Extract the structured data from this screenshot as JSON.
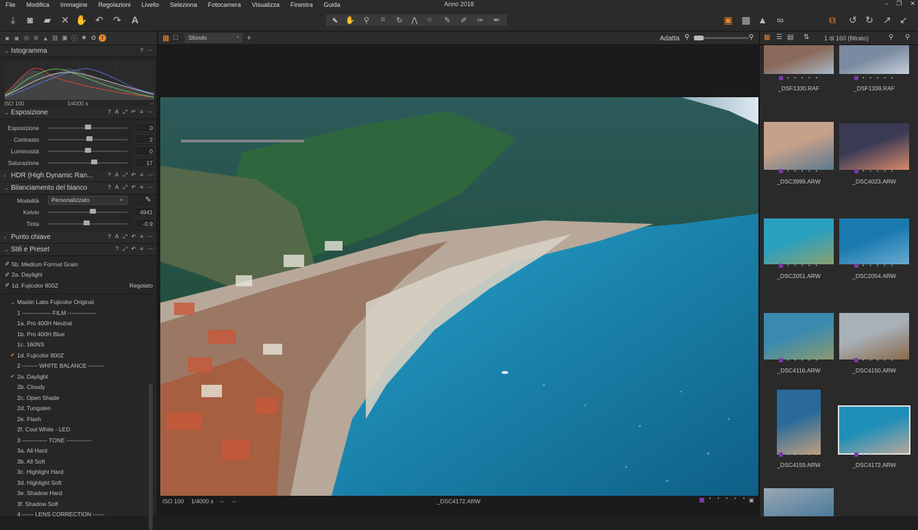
{
  "menu": {
    "items": [
      "File",
      "Modifica",
      "Immagine",
      "Regolazioni",
      "Livello",
      "Seleziona",
      "Fotocamera",
      "Visualizza",
      "Finestra",
      "Guida"
    ],
    "title": "Anno 2018"
  },
  "left": {
    "histogram": {
      "title": "Istogramma",
      "iso": "ISO 100",
      "shutter": "1/4000 s",
      "dash": "--"
    },
    "exposure": {
      "title": "Esposizione",
      "sliders": [
        {
          "label": "Esposizione",
          "value": "0",
          "pos": 0.5
        },
        {
          "label": "Contrasto",
          "value": "2",
          "pos": 0.52
        },
        {
          "label": "Luminosità",
          "value": "0",
          "pos": 0.5
        },
        {
          "label": "Saturazione",
          "value": "17",
          "pos": 0.58
        }
      ]
    },
    "hdr": {
      "title": "HDR (High Dynamic Ran..."
    },
    "wb": {
      "title": "Bilanciamento del bianco",
      "mode_label": "Modalità",
      "mode_value": "Personalizzato",
      "sliders": [
        {
          "label": "Kelvin",
          "value": "4941",
          "pos": 0.56
        },
        {
          "label": "Tinta",
          "value": "-0.9",
          "pos": 0.48
        }
      ]
    },
    "keypoint": {
      "title": "Punto chiave"
    },
    "styles": {
      "title": "Stili e Preset",
      "applied": [
        "5b. Medium Format Grain",
        "2a. Daylight",
        "1d. Fujicolor 800Z"
      ],
      "adjusted": "Regolato",
      "group": "Mastin Labs Fujicolor Original",
      "presets": [
        {
          "name": "1 --------------- FILM ---------------",
          "checked": false
        },
        {
          "name": "1a. Pro 400H Neutral",
          "checked": false
        },
        {
          "name": "1b. Pro 400H Blue",
          "checked": false
        },
        {
          "name": "1c. 160NS",
          "checked": false
        },
        {
          "name": "1d. Fujicolor 800Z",
          "checked": true
        },
        {
          "name": "2 -------- WHITE BALANCE --------",
          "checked": false
        },
        {
          "name": "2a. Daylight",
          "checked": true
        },
        {
          "name": "2b. Cloudy",
          "checked": false
        },
        {
          "name": "2c. Open Shade",
          "checked": false
        },
        {
          "name": "2d. Tungsten",
          "checked": false
        },
        {
          "name": "2e. Flash",
          "checked": false
        },
        {
          "name": "2f. Cool White - LED",
          "checked": false
        },
        {
          "name": "3 ------------- TONE -------------",
          "checked": false
        },
        {
          "name": "3a. All Hard",
          "checked": false
        },
        {
          "name": "3b. All Soft",
          "checked": false
        },
        {
          "name": "3c. Highlight Hard",
          "checked": false
        },
        {
          "name": "3d. Highlight Soft",
          "checked": false
        },
        {
          "name": "3e. Shadow Hard",
          "checked": false
        },
        {
          "name": "3f. Shadow Soft",
          "checked": false
        },
        {
          "name": "4 ------ LENS CORRECTION ------",
          "checked": false
        }
      ]
    }
  },
  "viewer": {
    "background_select": "Sfondo",
    "fit_label": "Adatta",
    "iso": "ISO 100",
    "shutter": "1/4000 s",
    "dashes": "--",
    "filename": "_DSC4172.ARW"
  },
  "browser": {
    "count": "1 di 160 (filtrato)",
    "thumbs": [
      {
        "name": "_DSF1330.RAF"
      },
      {
        "name": "_DSF1339.RAF"
      },
      {
        "name": "_DSC3999.ARW"
      },
      {
        "name": "_DSC4023.ARW"
      },
      {
        "name": "_DSC2051.ARW"
      },
      {
        "name": "_DSC2054.ARW"
      },
      {
        "name": "_DSC4116.ARW"
      },
      {
        "name": "_DSC4150.ARW"
      },
      {
        "name": "_DSC4159.ARW"
      },
      {
        "name": "_DSC4172.ARW"
      }
    ]
  },
  "colors": {
    "accent": "#e8842c",
    "color_tag": "#7a3aa6"
  }
}
